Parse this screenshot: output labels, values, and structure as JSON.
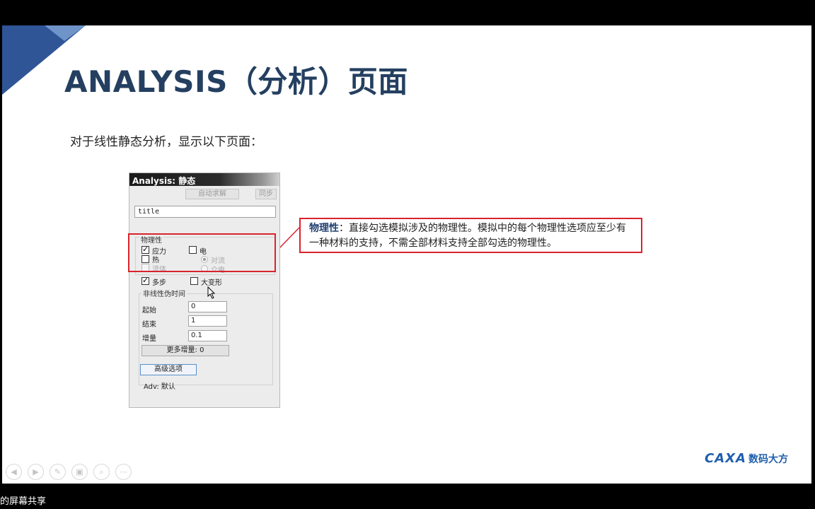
{
  "slide": {
    "title": "ANALYSIS（分析）页面",
    "subtitle": "对于线性静态分析，显示以下页面："
  },
  "dialog": {
    "title": "Analysis: 静态",
    "auto_solve_label": "自动求解",
    "sync_label": "同步",
    "title_field_value": "title",
    "physics_group_label": "物理性",
    "physics": {
      "stress": {
        "label": "应力",
        "checked": true
      },
      "electric": {
        "label": "电",
        "checked": false
      },
      "heat": {
        "label": "热",
        "checked": false
      },
      "convection": {
        "label": "对流",
        "selected": true
      },
      "fluid": {
        "label": "流体",
        "checked": false
      },
      "medium": {
        "label": "介电",
        "selected": false
      }
    },
    "multistep": {
      "label": "多步",
      "checked": true
    },
    "large_deformation": {
      "label": "大变形",
      "checked": false
    },
    "nonlinear_group_label": "非线性伪时间",
    "start_label": "起始",
    "start_value": "0",
    "end_label": "结束",
    "end_value": "1",
    "increment_label": "增量",
    "increment_value": "0.1",
    "more_increments_label": "更多增量: 0",
    "advanced_button_label": "高级选项",
    "adv_status": "Adv: 默认"
  },
  "callout": {
    "term": "物理性",
    "text": "：直接勾选模拟涉及的物理性。模拟中的每个物理性选项应至少有一种材料的支持，不需全部材料支持全部勾选的物理性。"
  },
  "nav_icons": [
    "prev-icon",
    "next-icon",
    "pen-icon",
    "slides-icon",
    "zoom-icon",
    "more-icon"
  ],
  "logo": {
    "brand": "CAXA",
    "name": "数码大方"
  },
  "share_text": "的屏幕共享",
  "colors": {
    "title": "#243f60",
    "accent_red": "#d9232d",
    "brand_blue": "#1f5fae"
  }
}
